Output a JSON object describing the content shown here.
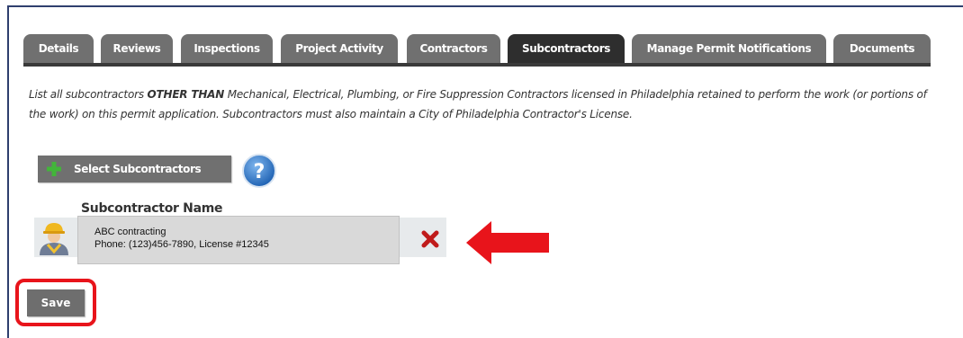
{
  "tabs": [
    {
      "label": "Details",
      "active": false
    },
    {
      "label": "Reviews",
      "active": false
    },
    {
      "label": "Inspections",
      "active": false
    },
    {
      "label": "Project Activity",
      "active": false
    },
    {
      "label": "Contractors",
      "active": false
    },
    {
      "label": "Subcontractors",
      "active": true
    },
    {
      "label": "Manage Permit Notifications",
      "active": false
    },
    {
      "label": "Documents",
      "active": false
    }
  ],
  "intro": {
    "part1": "List all subcontractors ",
    "emphasis": "OTHER THAN",
    "part2": " Mechanical, Electrical, Plumbing, or Fire Suppression Contractors licensed in Philadelphia retained to perform the work (or portions of the work) on this permit application. Subcontractors must also maintain a City of Philadelphia Contractor's License."
  },
  "actions": {
    "select_label": "Select Subcontractors",
    "select_icon": "plus-icon",
    "help_icon": "help-icon",
    "save_label": "Save"
  },
  "table": {
    "column_header": "Subcontractor Name",
    "rows": [
      {
        "name": "ABC contracting",
        "details": "Phone: (123)456-7890, License #12345",
        "avatar_icon": "worker-avatar-icon",
        "remove_icon": "remove-x-icon"
      }
    ]
  },
  "annotations": {
    "arrow_color": "#e8141b",
    "highlight_color": "#e8141b"
  }
}
